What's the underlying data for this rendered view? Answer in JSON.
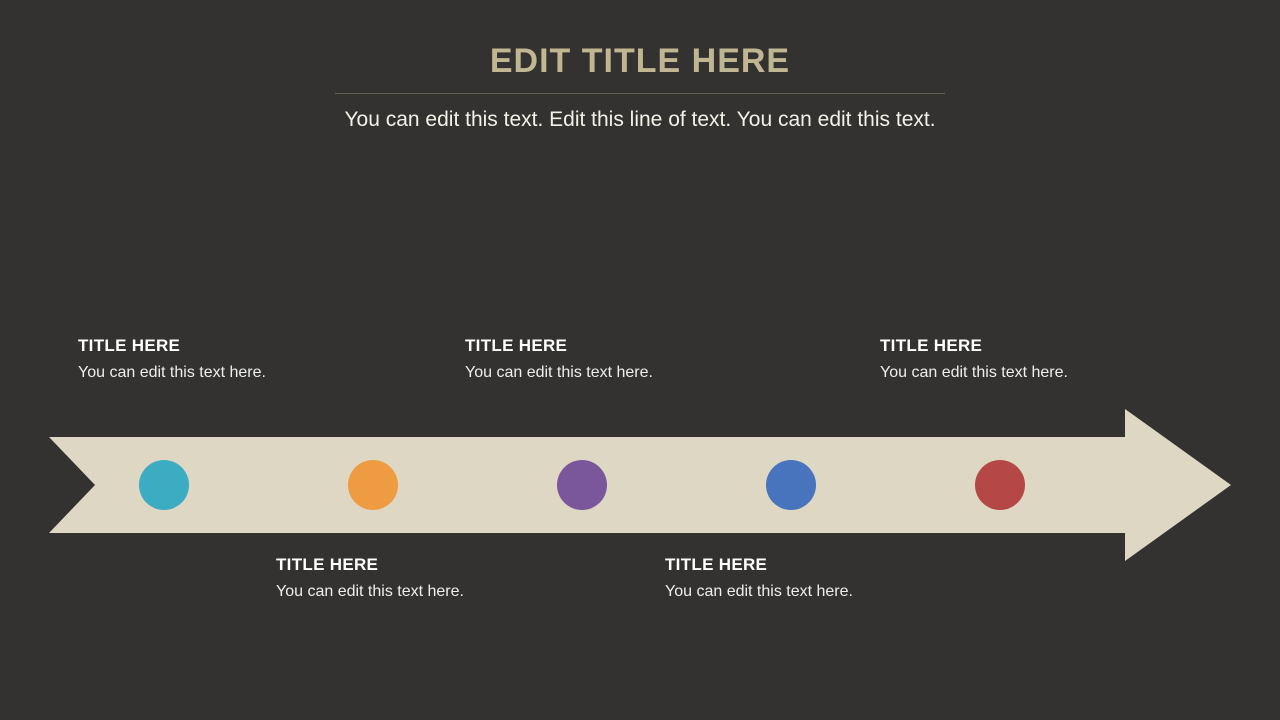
{
  "header": {
    "title": "EDIT TITLE  HERE",
    "subtitle": "You can edit this text. Edit this line of text. You can edit this text."
  },
  "colors": {
    "bg": "#333230",
    "arrow": "#ded7c3",
    "titleAccent": "#c1b692"
  },
  "timeline": {
    "items": [
      {
        "label": "TITLE HERE",
        "body": "You can edit this text here.",
        "dotColor": "#3cacc3",
        "dotLeft": 90,
        "position": "top",
        "calloutLeft": 78,
        "calloutTop": 336
      },
      {
        "label": "TITLE HERE",
        "body": "You can edit this text here.",
        "dotColor": "#ee9b41",
        "dotLeft": 299,
        "position": "bottom",
        "calloutLeft": 276,
        "calloutTop": 555
      },
      {
        "label": "TITLE HERE",
        "body": "You can edit this text here.",
        "dotColor": "#7a579b",
        "dotLeft": 508,
        "position": "top",
        "calloutLeft": 465,
        "calloutTop": 336
      },
      {
        "label": "TITLE HERE",
        "body": "You can edit this text here.",
        "dotColor": "#4774bc",
        "dotLeft": 717,
        "position": "bottom",
        "calloutLeft": 665,
        "calloutTop": 555
      },
      {
        "label": "TITLE HERE",
        "body": "You can edit this text here.",
        "dotColor": "#b54747",
        "dotLeft": 926,
        "position": "top",
        "calloutLeft": 880,
        "calloutTop": 336
      }
    ]
  }
}
